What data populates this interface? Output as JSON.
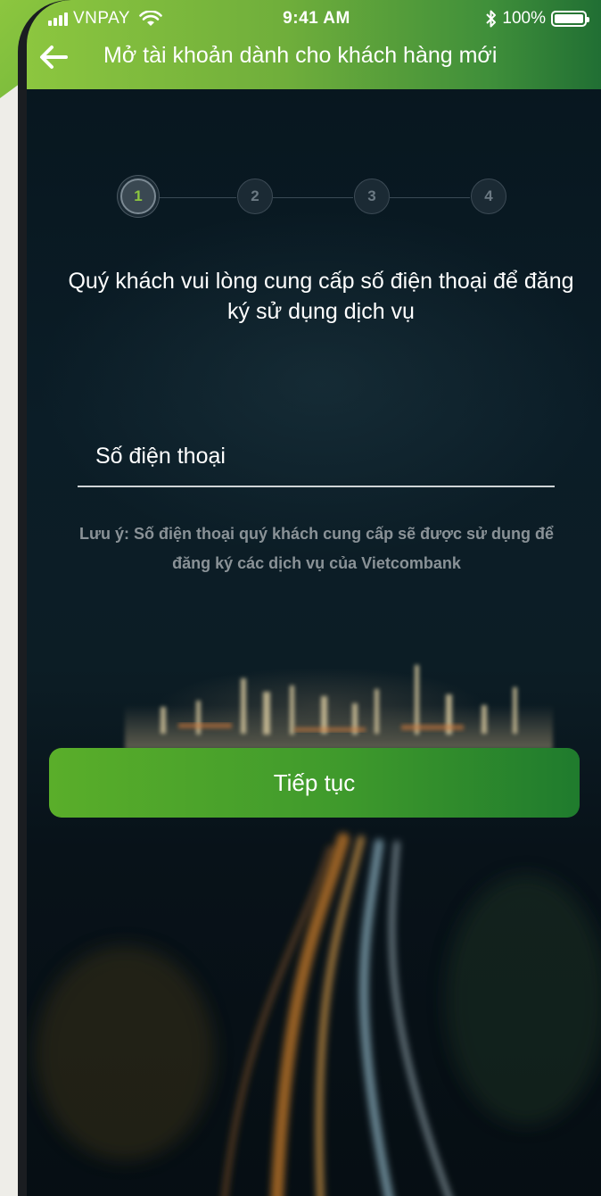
{
  "status_bar": {
    "carrier": "VNPAY",
    "time": "9:41 AM",
    "battery": "100%"
  },
  "nav": {
    "title": "Mở tài khoản dành cho khách hàng mới"
  },
  "stepper": {
    "steps": [
      "1",
      "2",
      "3",
      "4"
    ],
    "current": 1
  },
  "instruction": "Quý khách vui lòng cung cấp số điện thoại để đăng ký sử dụng dịch vụ",
  "phone_field": {
    "placeholder": "Số điện thoại",
    "value": ""
  },
  "note": "Lưu ý: Số điện thoại quý khách cung cấp sẽ được sử dụng để đăng ký các dịch vụ của Vietcombank",
  "continue_button": {
    "label": "Tiếp tục"
  },
  "colors": {
    "brand_green": "#8cc63f",
    "dark_green": "#1f7b2d",
    "background_dark": "#0b1d27"
  }
}
